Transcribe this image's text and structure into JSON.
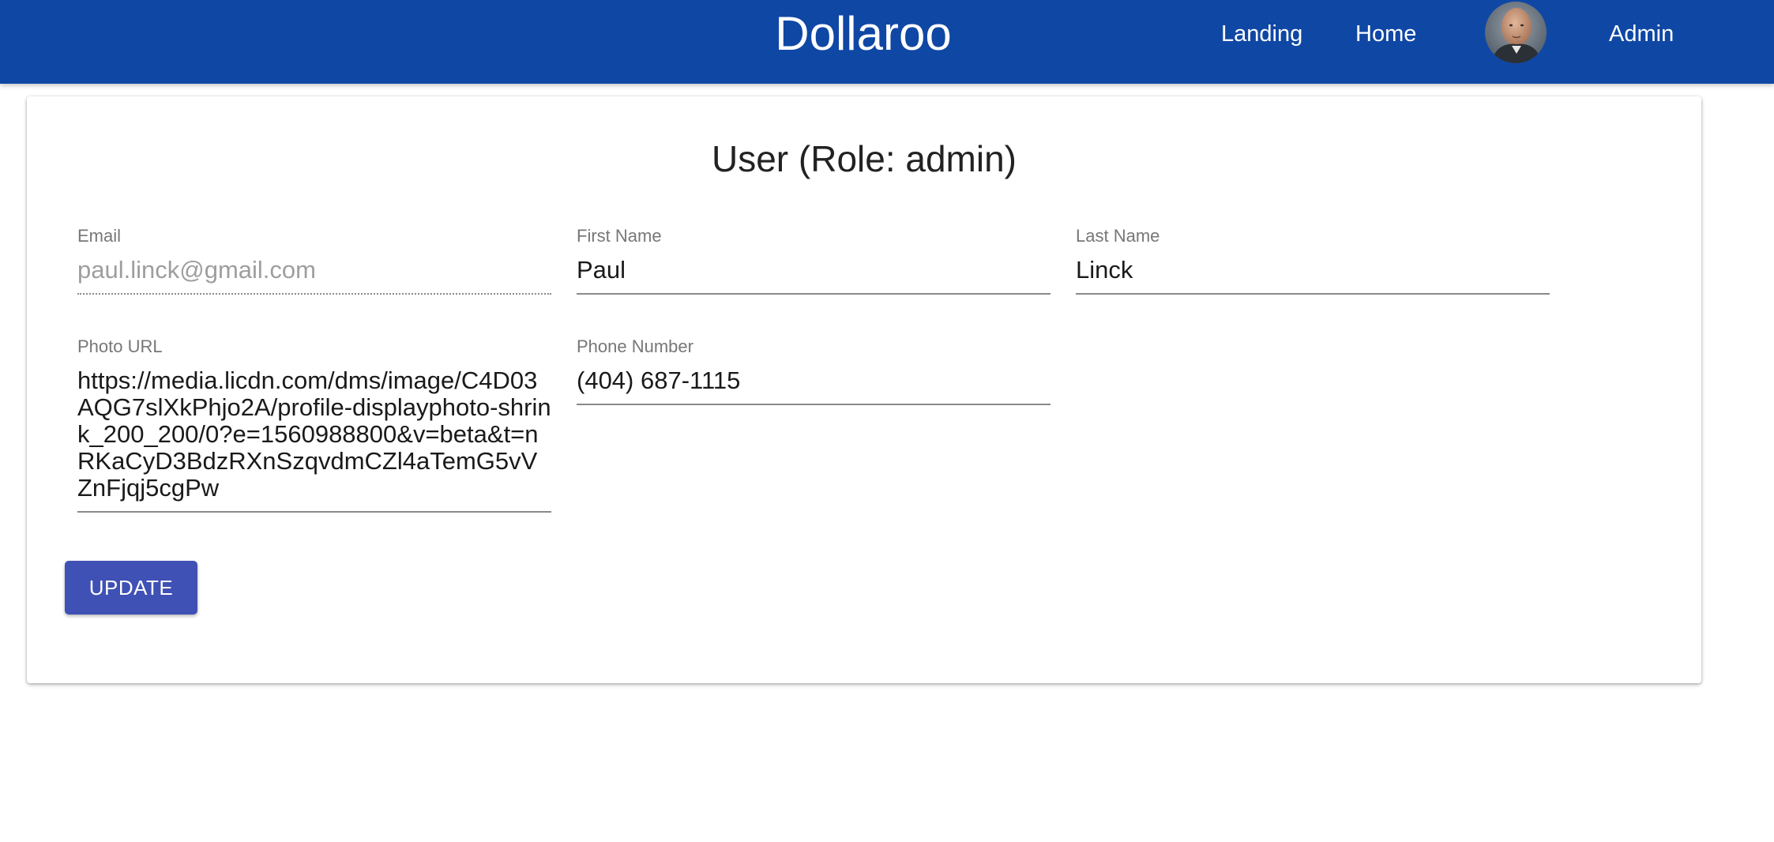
{
  "appbar": {
    "brand": "Dollaroo",
    "nav": {
      "landing": "Landing",
      "home": "Home",
      "admin": "Admin"
    },
    "color": "#0f47a4"
  },
  "card": {
    "title": "User (Role: admin)",
    "fields": {
      "email": {
        "label": "Email",
        "value": "paul.linck@gmail.com",
        "disabled": true
      },
      "first_name": {
        "label": "First Name",
        "value": "Paul"
      },
      "last_name": {
        "label": "Last Name",
        "value": "Linck"
      },
      "photo_url": {
        "label": "Photo URL",
        "value": "https://media.licdn.com/dms/image/C4D03AQG7slXkPhjo2A/profile-displayphoto-shrink_200_200/0?e=1560988800&v=beta&t=nRKaCyD3BdzRXnSzqvdmCZl4aTemG5vVZnFjqj5cgPw"
      },
      "phone": {
        "label": "Phone Number",
        "value": "(404) 687-1115"
      }
    },
    "update_label": "UPDATE",
    "button_color": "#3f51b5"
  }
}
